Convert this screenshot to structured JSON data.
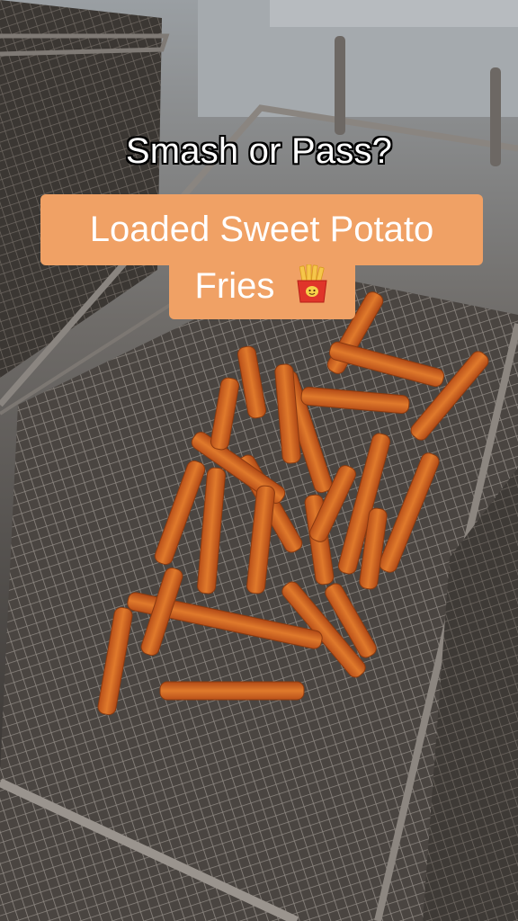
{
  "overlay": {
    "question": "Smash or Pass?",
    "caption_line1": "Loaded Sweet Potato",
    "caption_line2": "Fries"
  },
  "icons": {
    "caption_emoji": "french-fries-emoji"
  },
  "colors": {
    "caption_background": "#f0a165",
    "caption_text": "#ffffff",
    "fry": "#d76a24"
  }
}
